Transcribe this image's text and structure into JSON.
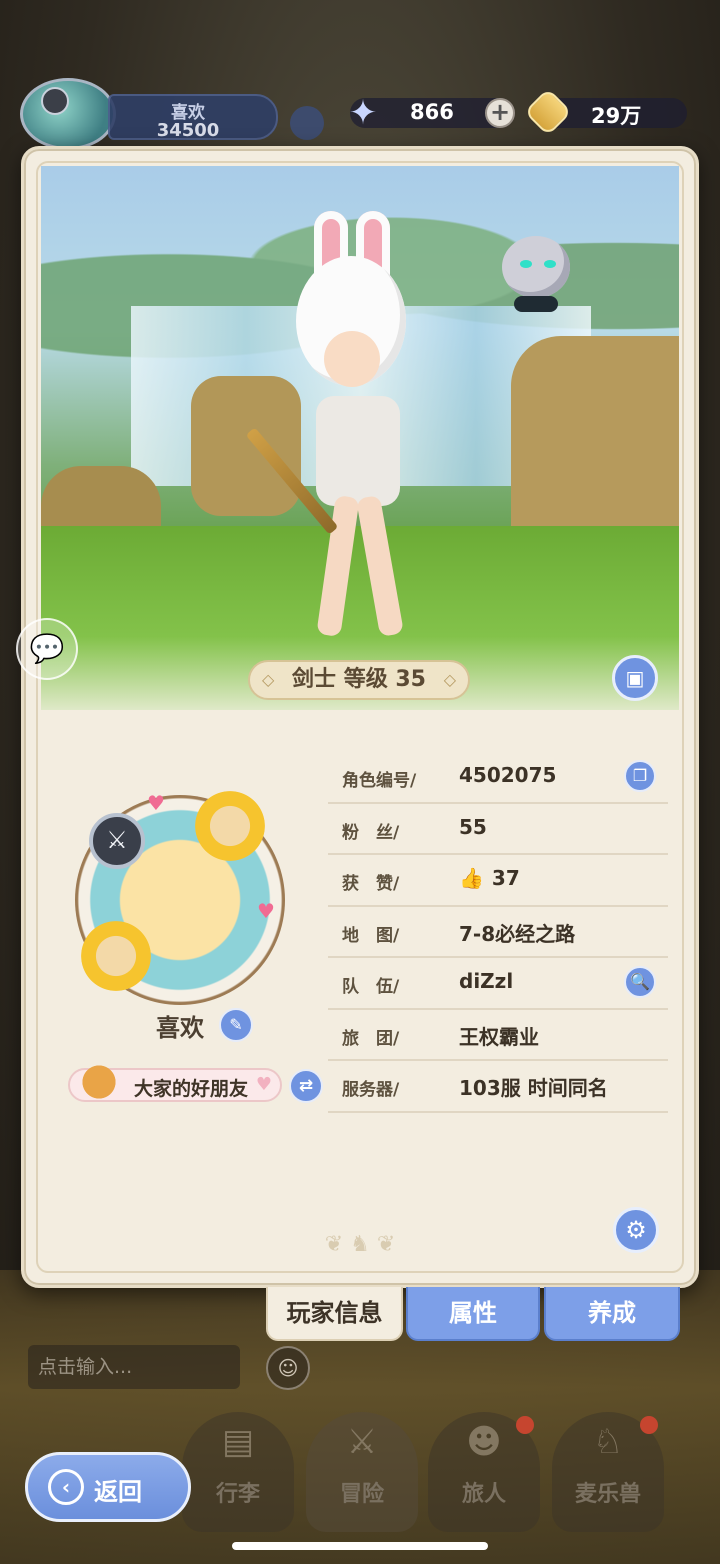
{
  "header": {
    "player_name": "喜欢",
    "player_power": "34500",
    "currency": {
      "gems": "866",
      "gold": "29万"
    }
  },
  "scene": {
    "class_level": "剑士 等级 35"
  },
  "profile": {
    "nickname": "喜欢",
    "title_badge": "大家的好朋友",
    "rows": [
      {
        "label": "角色编号/",
        "value": "4502075"
      },
      {
        "label": "粉　丝/",
        "value": "55"
      },
      {
        "label": "获　赞/",
        "value": "37"
      },
      {
        "label": "地　图/",
        "value": "7-8必经之路"
      },
      {
        "label": "队　伍/",
        "value": "diZzl"
      },
      {
        "label": "旅　团/",
        "value": "王权霸业"
      },
      {
        "label": "服务器/",
        "value": "103服  时间同名"
      }
    ]
  },
  "tabs": {
    "player_info": "玩家信息",
    "attributes": "属性",
    "develop": "养成"
  },
  "chat": {
    "placeholder": "点击输入..."
  },
  "nav": {
    "luggage": "行李",
    "adventure": "冒险",
    "travelers": "旅人",
    "pets": "麦乐兽",
    "back": "返回"
  },
  "colors": {
    "accent_blue": "#6f93e0",
    "card_bg": "#f3ede0"
  }
}
